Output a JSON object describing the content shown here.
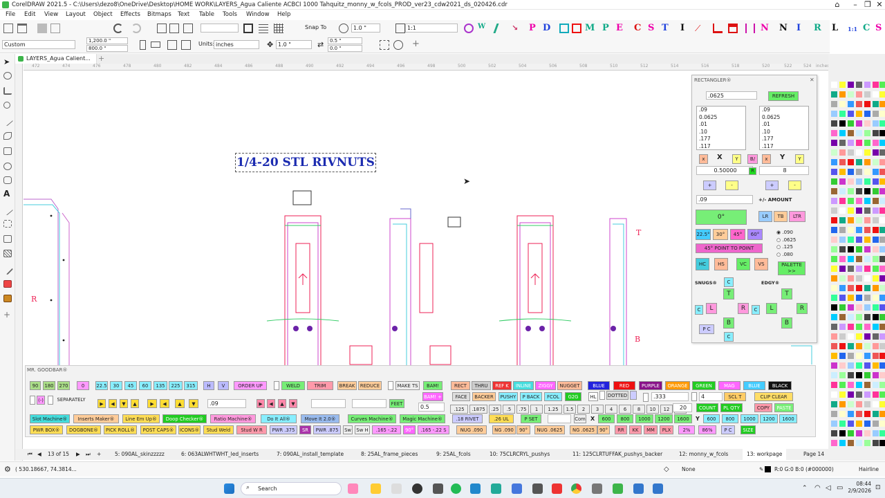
{
  "window": {
    "title": "CorelDRAW 2021.5 - C:\\Users\\dezo8\\OneDrive\\Desktop\\HOME WORK\\LAYERS_Agua Caliente ACBCI 1000 Tahquitz_monny_w_fcols_PROD_ver23_cdw2021_ds_020426.cdr"
  },
  "menu": [
    "File",
    "Edit",
    "View",
    "Layout",
    "Object",
    "Effects",
    "Bitmaps",
    "Text",
    "Table",
    "Tools",
    "Window",
    "Help"
  ],
  "toolbar": {
    "zoom": "",
    "snap_to": "Snap To",
    "outline": "1.0 \"",
    "ratio": "1:1"
  },
  "props": {
    "preset": "Custom",
    "width": "1,200.0 \"",
    "height": "800.0 \"",
    "units_label": "Units:",
    "units": "inches",
    "nudge": "1.0 \"",
    "dup_x": "0.5 \"",
    "dup_y": "0.0 \""
  },
  "doc_tab": "LAYERS_Agua Calient...",
  "ruler": [
    "472",
    "474",
    "476",
    "478",
    "480",
    "482",
    "484",
    "486",
    "488",
    "490",
    "492",
    "494",
    "496",
    "498",
    "500",
    "502",
    "504",
    "506",
    "508",
    "510",
    "512",
    "514",
    "516",
    "518",
    "520",
    "522",
    "524"
  ],
  "ruler_unit": "inches",
  "canvas": {
    "title": "1/4-20 STL RIVNUTS",
    "mark_r": "R",
    "mark_t": "T",
    "mark_b": "B"
  },
  "rect": {
    "title": "RECTANGLER®",
    "val1": ".0625",
    "refresh": "REFRESH",
    "list1": [
      ".09",
      "0.0625",
      ".01",
      ".10",
      ".177",
      ".117"
    ],
    "list2": [
      ".09",
      "0.0625",
      ".01",
      ".10",
      ".177",
      ".117"
    ],
    "x": "X",
    "y": "Y",
    "x_small": "x",
    "y_small": "Y",
    "bf": "B/",
    "num1": "0.50000",
    "r": "R",
    "num2": "8",
    "plus": "+",
    "minus": "-",
    "amount": ".09",
    "amount_label": "+/- AMOUNT",
    "deg0": "0°",
    "lr": "LR",
    "tb": "TB",
    "ltr": "LTR",
    "a225": "22.5°",
    "a30": "30°",
    "a45": "45°",
    "a60": "60°",
    "p2p": "45° POINT TO POINT",
    "radios": [
      ".090",
      ".0625",
      ".125",
      ".080"
    ],
    "hc": "HC",
    "hs": "HS",
    "vc": "VC",
    "vs": "VS",
    "palette": "PALETTE >>",
    "snugs": "SNUGS®",
    "edgy": "EDGY®",
    "c": "C",
    "t": "T",
    "l": "L",
    "b": "B",
    "pc": "P C"
  },
  "goodbar": {
    "title": "MR. GOODBAR®",
    "row1": {
      "a90": "90",
      "a180": "180",
      "a270": "270",
      "a0": "0",
      "a225": "22.5",
      "a30": "30",
      "a45": "45",
      "a60": "60",
      "a135": "135",
      "a225b": "225",
      "a315": "315",
      "h": "H",
      "v": "V",
      "order": "ORDER UP",
      "weld": "WELD",
      "trim": "TRIM",
      "break": "BREAK",
      "reduce": "REDUCE",
      "makets": "MAKE TS",
      "bam": "BAM!",
      "rect": "RECT",
      "thru": "THRU",
      "refk": "REF K",
      "inline": "INLINE",
      "ziggy": "ZIGGY",
      "nugget": "NUGGET",
      "blue": "BLUE",
      "red": "RED",
      "purple": "PURPLE",
      "orange": "ORANGE",
      "green": "GREEN",
      "mag": "MAG",
      "blue2": "BLUE",
      "black": "BLACK"
    },
    "row2": {
      "sep": "SEPARATELY",
      "minus": "(-)",
      "dd": ".09",
      "feet": "FEET",
      "bamplus": "BAM! +",
      "face": "FACE",
      "backer": "BACKER",
      "pushy": "PUSHY",
      "pback": "P BACK",
      "fcol": "FCOL",
      "g2g": "G2G",
      "hl": "HL",
      "dotted": "DOTTED",
      "v333": ".333",
      "v4": "4",
      "scl": "SCL T",
      "clip": "CLIP CLEAR"
    },
    "row3": {
      "v05": "0.5",
      "sizes": [
        ".125",
        ".1875",
        ".25",
        ".5",
        ".75",
        "1",
        "1.25",
        "1.5",
        "2",
        "3",
        "4",
        "6",
        "8",
        "10",
        "12",
        ">"
      ],
      "v20": "20",
      "count": "COUNT",
      "plqty": "PL QTY",
      "copy": "COPY",
      "paste": "PASTE"
    },
    "row4": {
      "slot": "Slot Machine®",
      "inserts": "Inserts Maker®",
      "lineup": "Line Em Up®",
      "doop": "Doop Checker®",
      "ratio": "Ratio Machine®",
      "doit": "Do It All®",
      "move": "Move It 2.0®",
      "curves": "Curves Machine®",
      "magic": "Magic Machine®",
      "rivet": ".18 RIVET",
      "ul": ".26 UL",
      "pset": "P SET",
      "com": "Com",
      "x": "X",
      "y": "Y",
      "xs": [
        "600",
        "800",
        "1000",
        "1200",
        "1600"
      ],
      "ys": [
        "600",
        "800",
        "1000",
        "1200",
        "1600"
      ]
    },
    "row5": {
      "pwrbox": "PWR BOX®",
      "dogbone": "DOGBONE®",
      "pickroll": "PICK ROLL®",
      "postcaps": "POST CAPS®",
      "icons": "ICONS®",
      "stud": "Stud Weld",
      "studwr": "Stud W R",
      "pwr375": "PWR .375",
      "sr": "SR",
      "pwr875": "PWR .875",
      "sw": "Sw",
      "swh": "Sw H",
      "d1": ".165 -.22",
      "deg90": "90°",
      "d2": ".165 -.22 S",
      "nug090": "NUG .090",
      "ng090": "NG .090",
      "n90": "90°",
      "nug0625": "NUG .0625",
      "ng0625": "NG .0625",
      "n90b": "90°",
      "rr": "RR",
      "kk": "KK",
      "mm": "MM",
      "plx": "PLX",
      "p2": "2%",
      "p86": "86%",
      "pc": "P C",
      "size": "SIZE"
    }
  },
  "pages": {
    "counter": "13 of 15",
    "tabs": [
      "5: 090AL_skinzzzzz",
      "6: 063ALWHTWHT_led_inserts",
      "7: 090AL_install_template",
      "8: 25AL_frame_pieces",
      "9: 25AL_fcols",
      "10: 75CLRCRYL_pushys",
      "11: 125CLRTUFFAK_pushys_backer",
      "12: monny_w_fcols",
      "13: workpage"
    ],
    "page_label": "Page 14"
  },
  "status": {
    "coords": "( 530.18667, 74.3814...",
    "fill": "None",
    "color": "R:0 G:0 B:0 (#000000)",
    "outline": "Hairline"
  },
  "taskbar": {
    "search": "Search",
    "time": "08:44",
    "date": "2/9/2026"
  }
}
